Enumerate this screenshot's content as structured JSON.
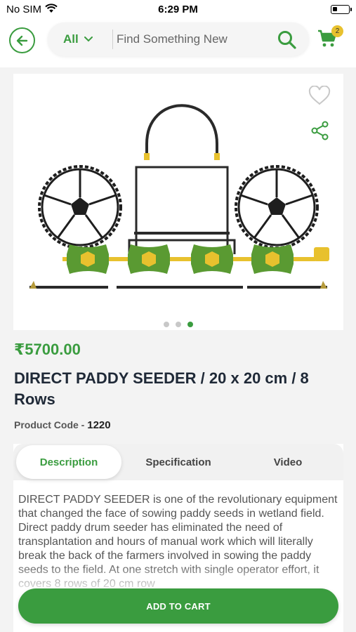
{
  "status_bar": {
    "carrier": "No SIM",
    "time": "6:29 PM",
    "wifi_icon": "wifi-icon",
    "battery_icon": "battery-icon"
  },
  "header": {
    "back_icon": "arrow-left-icon",
    "search": {
      "filter_label": "All",
      "placeholder": "Find Something New",
      "value": ""
    },
    "cart": {
      "icon": "cart-icon",
      "badge": "2"
    }
  },
  "product": {
    "image_icons": [
      "heart-icon",
      "share-icon"
    ],
    "carousel": {
      "total": 3,
      "active": 3
    },
    "price": "₹5700.00",
    "title": "DIRECT PADDY SEEDER / 20 x 20 cm / 8 Rows",
    "code_label": "Product Code -",
    "code_value": "1220"
  },
  "tabs": [
    {
      "label": "Description",
      "active": true
    },
    {
      "label": "Specification",
      "active": false
    },
    {
      "label": "Video",
      "active": false
    }
  ],
  "description": "DIRECT PADDY SEEDER   is one of the revolutionary equipment that changed the face of sowing paddy seeds in wetland field. Direct paddy drum seeder has eliminated the need of transplantation and hours of manual work which will literally break the back of the farmers involved in sowing the paddy seeds to the field. At one stretch with single operator effort, it covers 8 rows of 20 cm row",
  "add_to_cart_label": "ADD TO CART",
  "colors": {
    "accent": "#3a9c3f",
    "badge": "#e8c12e",
    "drum": "#5a9a32",
    "cap": "#e8c12e"
  }
}
